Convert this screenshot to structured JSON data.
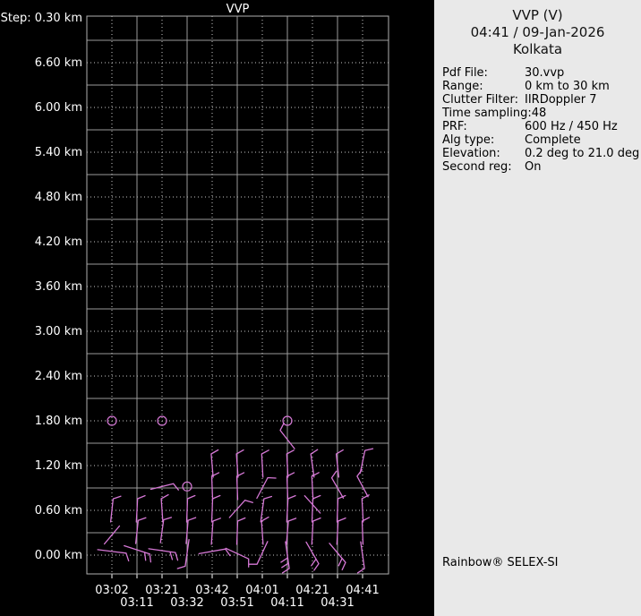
{
  "panel": {
    "header": [
      "VVP (V)",
      "04:41 / 09-Jan-2026",
      "Kolkata"
    ],
    "rows": [
      {
        "label": "Pdf File:",
        "value": "30.vvp"
      },
      {
        "label": "Range:",
        "value": "0 km to 30 km"
      },
      {
        "label": "Clutter Filter:",
        "value": "IIRDoppler 7"
      },
      {
        "label": "Time sampling:",
        "value": "48"
      },
      {
        "label": "PRF:",
        "value": "600 Hz / 450 Hz"
      },
      {
        "label": "Alg type:",
        "value": "Complete"
      },
      {
        "label": "Elevation:",
        "value": "0.2 deg to 21.0 deg"
      },
      {
        "label": "Second reg:",
        "value": "On"
      }
    ],
    "footer": "Rainbow® SELEX-SI"
  },
  "chart_data": {
    "type": "wind-barb-profile",
    "title": "VVP",
    "step_label": "Step: 0.30 km",
    "altitude_step_km": 0.3,
    "altitude_label_step_km": 0.6,
    "y_ticks": [
      {
        "alt": 6.6,
        "label": "6.60 km"
      },
      {
        "alt": 6.0,
        "label": "6.00 km"
      },
      {
        "alt": 5.4,
        "label": "5.40 km"
      },
      {
        "alt": 4.8,
        "label": "4.80 km"
      },
      {
        "alt": 4.2,
        "label": "4.20 km"
      },
      {
        "alt": 3.6,
        "label": "3.60 km"
      },
      {
        "alt": 3.0,
        "label": "3.00 km"
      },
      {
        "alt": 2.4,
        "label": "2.40 km"
      },
      {
        "alt": 1.8,
        "label": "1.80 km"
      },
      {
        "alt": 1.2,
        "label": "1.20 km"
      },
      {
        "alt": 0.6,
        "label": "0.60 km"
      },
      {
        "alt": 0.0,
        "label": "0.00 km"
      }
    ],
    "x_ticks": [
      {
        "time": "03:02",
        "row": 1
      },
      {
        "time": "03:11",
        "row": 2
      },
      {
        "time": "03:21",
        "row": 1
      },
      {
        "time": "03:32",
        "row": 2
      },
      {
        "time": "03:42",
        "row": 1
      },
      {
        "time": "03:51",
        "row": 2
      },
      {
        "time": "04:01",
        "row": 1
      },
      {
        "time": "04:11",
        "row": 2
      },
      {
        "time": "04:21",
        "row": 1
      },
      {
        "time": "04:31",
        "row": 2
      },
      {
        "time": "04:41",
        "row": 1
      }
    ],
    "calm": [
      {
        "time": "03:02",
        "alt": 1.8
      },
      {
        "time": "03:21",
        "alt": 1.8
      },
      {
        "time": "04:11",
        "alt": 1.8
      },
      {
        "time": "03:32",
        "alt": 0.92
      }
    ],
    "barbs": [
      {
        "time": "03:02",
        "alt": 0.6,
        "rot": 6,
        "flags": 1
      },
      {
        "time": "03:02",
        "alt": 0.27,
        "rot": 40,
        "flags": 0
      },
      {
        "time": "03:02",
        "alt": 0.05,
        "rot": 97,
        "flags": 1,
        "len": 32
      },
      {
        "time": "03:11",
        "alt": 0.6,
        "rot": 3,
        "flags": 1
      },
      {
        "time": "03:11",
        "alt": 0.31,
        "rot": 6,
        "flags": 1
      },
      {
        "time": "03:11",
        "alt": 0.07,
        "rot": 108,
        "flags": 2,
        "len": 30
      },
      {
        "time": "03:21",
        "alt": 0.92,
        "rot": 76,
        "flags": 1
      },
      {
        "time": "03:21",
        "alt": 0.6,
        "rot": -4,
        "flags": 1
      },
      {
        "time": "03:21",
        "alt": 0.32,
        "rot": 8,
        "flags": 1
      },
      {
        "time": "03:21",
        "alt": 0.06,
        "rot": 98,
        "flags": 2,
        "len": 30
      },
      {
        "time": "03:32",
        "alt": 0.6,
        "rot": 2,
        "flags": 1
      },
      {
        "time": "03:32",
        "alt": 0.31,
        "rot": 5,
        "flags": 1
      },
      {
        "time": "03:32",
        "alt": 0.03,
        "rot": 188,
        "flags": 1,
        "len": 30
      },
      {
        "time": "03:42",
        "alt": 1.2,
        "rot": -5,
        "flags": 1
      },
      {
        "time": "03:42",
        "alt": 0.9,
        "rot": -2,
        "flags": 1
      },
      {
        "time": "03:42",
        "alt": 0.6,
        "rot": 2,
        "flags": 1
      },
      {
        "time": "03:42",
        "alt": 0.3,
        "rot": 4,
        "flags": 1
      },
      {
        "time": "03:42",
        "alt": 0.05,
        "rot": 80,
        "flags": 1,
        "len": 30
      },
      {
        "time": "03:51",
        "alt": 1.2,
        "rot": -4,
        "flags": 1
      },
      {
        "time": "03:51",
        "alt": 0.9,
        "rot": -2,
        "flags": 1
      },
      {
        "time": "03:51",
        "alt": 0.62,
        "rot": 42,
        "flags": 1
      },
      {
        "time": "03:51",
        "alt": 0.3,
        "rot": 2,
        "flags": 1
      },
      {
        "time": "03:51",
        "alt": 0.02,
        "rot": 115,
        "flags": 1,
        "len": 28
      },
      {
        "time": "04:01",
        "alt": 1.2,
        "rot": -3,
        "flags": 1
      },
      {
        "time": "04:01",
        "alt": 0.9,
        "rot": 28,
        "flags": 1
      },
      {
        "time": "04:01",
        "alt": 0.6,
        "rot": 8,
        "flags": 1
      },
      {
        "time": "04:01",
        "alt": 0.3,
        "rot": -4,
        "flags": 1
      },
      {
        "time": "04:01",
        "alt": 0.03,
        "rot": 205,
        "flags": 1,
        "len": 28
      },
      {
        "time": "04:11",
        "alt": 1.55,
        "rot": -38,
        "flags": 1
      },
      {
        "time": "04:11",
        "alt": 1.2,
        "rot": -3,
        "flags": 1
      },
      {
        "time": "04:11",
        "alt": 0.9,
        "rot": -2,
        "flags": 1
      },
      {
        "time": "04:11",
        "alt": 0.6,
        "rot": 3,
        "flags": 1
      },
      {
        "time": "04:11",
        "alt": 0.3,
        "rot": 5,
        "flags": 1
      },
      {
        "time": "04:11",
        "alt": 0.0,
        "rot": 172,
        "flags": 3,
        "len": 30
      },
      {
        "time": "04:21",
        "alt": 1.2,
        "rot": -8,
        "flags": 1
      },
      {
        "time": "04:21",
        "alt": 0.9,
        "rot": -3,
        "flags": 1
      },
      {
        "time": "04:21",
        "alt": 0.68,
        "rot": -42,
        "flags": 0
      },
      {
        "time": "04:21",
        "alt": 0.6,
        "rot": 2,
        "flags": 1
      },
      {
        "time": "04:21",
        "alt": 0.3,
        "rot": 3,
        "flags": 1
      },
      {
        "time": "04:21",
        "alt": 0.03,
        "rot": 150,
        "flags": 2,
        "len": 28
      },
      {
        "time": "04:31",
        "alt": 1.2,
        "rot": -6,
        "flags": 1
      },
      {
        "time": "04:31",
        "alt": 0.9,
        "rot": -30,
        "flags": 1
      },
      {
        "time": "04:31",
        "alt": 0.6,
        "rot": 2,
        "flags": 1
      },
      {
        "time": "04:31",
        "alt": 0.3,
        "rot": 3,
        "flags": 1
      },
      {
        "time": "04:31",
        "alt": 0.03,
        "rot": 140,
        "flags": 2,
        "len": 28
      },
      {
        "time": "04:41",
        "alt": 1.25,
        "rot": 12,
        "flags": 1
      },
      {
        "time": "04:41",
        "alt": 0.92,
        "rot": -28,
        "flags": 1
      },
      {
        "time": "04:41",
        "alt": 0.6,
        "rot": -3,
        "flags": 1
      },
      {
        "time": "04:41",
        "alt": 0.3,
        "rot": -2,
        "flags": 1
      },
      {
        "time": "04:41",
        "alt": 0.0,
        "rot": 172,
        "flags": 1,
        "len": 30
      }
    ],
    "colors": {
      "background": "#000000",
      "barb": "#d678d6",
      "grid_solid": "#9a9a9a",
      "grid_dotted": "#c8c8c8",
      "border": "#b0b0b0",
      "text": "#ffffff"
    }
  }
}
